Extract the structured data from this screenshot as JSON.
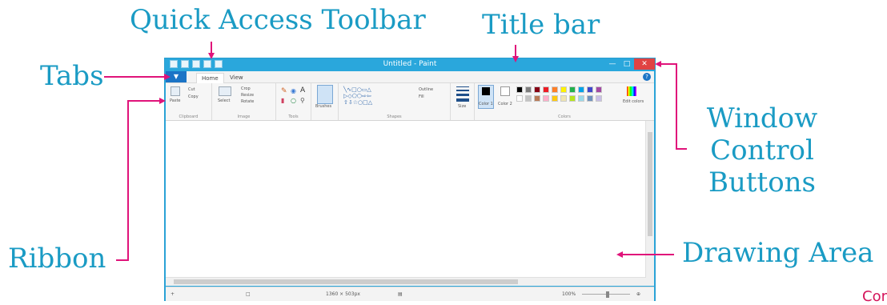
{
  "annotations": {
    "quick_access_toolbar": "Quick Access Toolbar",
    "title_bar": "Title bar",
    "tabs": "Tabs",
    "window_control_line1": "Window",
    "window_control_line2": "Control",
    "window_control_line3": "Buttons",
    "ribbon": "Ribbon",
    "drawing_area": "Drawing Area",
    "corner_fragment": "Cor"
  },
  "window": {
    "title": "Untitled - Paint",
    "tabs": {
      "file": "",
      "home": "Home",
      "view": "View"
    },
    "ribbon": {
      "clipboard": {
        "paste": "Paste",
        "cut": "Cut",
        "copy": "Copy",
        "label": "Clipboard"
      },
      "image": {
        "select": "Select",
        "crop": "Crop",
        "resize": "Resize",
        "rotate": "Rotate",
        "label": "Image"
      },
      "tools": {
        "label": "Tools"
      },
      "brushes": "Brushes",
      "shapes": {
        "outline": "Outline",
        "fill": "Fill",
        "label": "Shapes"
      },
      "size": "Size",
      "color1": "Color 1",
      "color2": "Color 2",
      "colors": {
        "edit": "Edit colors",
        "label": "Colors"
      }
    },
    "status": {
      "dimensions": "1360 × 503px",
      "zoom": "100%"
    }
  },
  "palette_top": [
    "#000000",
    "#7f7f7f",
    "#880015",
    "#ed1c24",
    "#ff7f27",
    "#fff200",
    "#22b14c",
    "#00a2e8",
    "#3f48cc",
    "#a349a4"
  ],
  "palette_bottom": [
    "#ffffff",
    "#c3c3c3",
    "#b97a57",
    "#ffaec9",
    "#ffc90e",
    "#efe4b0",
    "#b5e61d",
    "#99d9ea",
    "#7092be",
    "#c8bfe7"
  ],
  "accent_color": "#1a9bc4",
  "arrow_color": "#e0137a"
}
